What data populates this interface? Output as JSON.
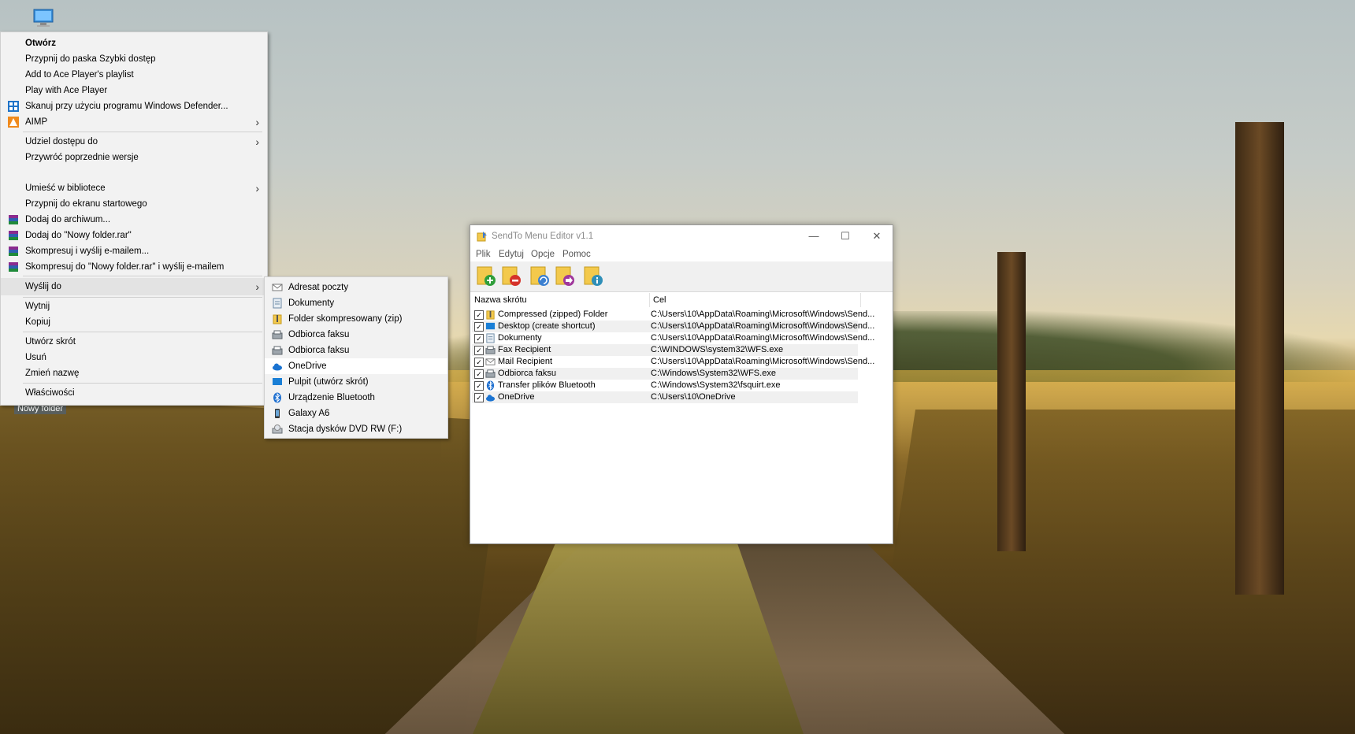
{
  "desktop": {
    "selected_folder_label": "Nowy folder"
  },
  "context_menu": {
    "items": [
      {
        "label": "Otwórz",
        "bold": true
      },
      {
        "label": "Przypnij do paska Szybki dostęp"
      },
      {
        "label": "Add to Ace Player's playlist"
      },
      {
        "label": "Play with Ace Player"
      },
      {
        "label": "Skanuj przy użyciu programu Windows Defender...",
        "icon": "windows-defender-icon"
      },
      {
        "label": "AIMP",
        "icon": "aimp-icon",
        "submenu": true
      },
      {
        "label": "Udziel dostępu do",
        "submenu": true
      },
      {
        "label": "Przywróć poprzednie wersje"
      },
      {
        "label": "Umieść w bibliotece",
        "submenu": true
      },
      {
        "label": "Przypnij do ekranu startowego"
      },
      {
        "label": "Dodaj do archiwum...",
        "icon": "winrar-icon"
      },
      {
        "label": "Dodaj do \"Nowy folder.rar\"",
        "icon": "winrar-icon"
      },
      {
        "label": "Skompresuj i wyślij e-mailem...",
        "icon": "winrar-icon"
      },
      {
        "label": "Skompresuj do \"Nowy folder.rar\" i wyślij e-mailem",
        "icon": "winrar-icon"
      },
      {
        "label": "Wyślij do",
        "submenu": true,
        "highlighted": true
      },
      {
        "label": "Wytnij"
      },
      {
        "label": "Kopiuj"
      },
      {
        "label": "Utwórz skrót"
      },
      {
        "label": "Usuń"
      },
      {
        "label": "Zmień nazwę"
      },
      {
        "label": "Właściwości"
      }
    ]
  },
  "send_to_submenu": {
    "items": [
      {
        "label": "Adresat poczty",
        "icon": "mail-icon"
      },
      {
        "label": "Dokumenty",
        "icon": "documents-icon"
      },
      {
        "label": "Folder skompresowany (zip)",
        "icon": "zip-folder-icon"
      },
      {
        "label": "Odbiorca faksu",
        "icon": "fax-icon"
      },
      {
        "label": "Odbiorca faksu",
        "icon": "fax-icon"
      },
      {
        "label": "OneDrive",
        "icon": "onedrive-icon",
        "highlighted": true
      },
      {
        "label": "Pulpit (utwórz skrót)",
        "icon": "desktop-icon"
      },
      {
        "label": "Urządzenie Bluetooth",
        "icon": "bluetooth-icon"
      },
      {
        "label": "Galaxy A6",
        "icon": "phone-icon"
      },
      {
        "label": "Stacja dysków DVD RW (F:)",
        "icon": "dvd-drive-icon"
      }
    ]
  },
  "editor_window": {
    "title": "SendTo Menu Editor v1.1",
    "menu": [
      "Plik",
      "Edytuj",
      "Opcje",
      "Pomoc"
    ],
    "toolbar": [
      {
        "icon": "add-icon"
      },
      {
        "icon": "remove-icon"
      },
      {
        "icon": "refresh-icon"
      },
      {
        "icon": "send-icon"
      },
      {
        "icon": "info-icon"
      }
    ],
    "columns": [
      "Nazwa skrótu",
      "Cel"
    ],
    "rows": [
      {
        "name": "Compressed (zipped) Folder",
        "target": "C:\\Users\\10\\AppData\\Roaming\\Microsoft\\Windows\\Send...",
        "checked": true,
        "icon": "zip-folder-icon"
      },
      {
        "name": "Desktop (create shortcut)",
        "target": "C:\\Users\\10\\AppData\\Roaming\\Microsoft\\Windows\\Send...",
        "checked": true,
        "icon": "desktop-icon"
      },
      {
        "name": "Dokumenty",
        "target": "C:\\Users\\10\\AppData\\Roaming\\Microsoft\\Windows\\Send...",
        "checked": true,
        "icon": "documents-icon"
      },
      {
        "name": "Fax Recipient",
        "target": "C:\\WINDOWS\\system32\\WFS.exe",
        "checked": true,
        "icon": "fax-icon"
      },
      {
        "name": "Mail Recipient",
        "target": "C:\\Users\\10\\AppData\\Roaming\\Microsoft\\Windows\\Send...",
        "checked": true,
        "icon": "mail-icon"
      },
      {
        "name": "Odbiorca faksu",
        "target": "C:\\Windows\\System32\\WFS.exe",
        "checked": true,
        "icon": "fax-icon"
      },
      {
        "name": "Transfer plików Bluetooth",
        "target": "C:\\Windows\\System32\\fsquirt.exe",
        "checked": true,
        "icon": "bluetooth-icon"
      },
      {
        "name": "OneDrive",
        "target": "C:\\Users\\10\\OneDrive",
        "checked": true,
        "icon": "onedrive-icon"
      }
    ]
  }
}
